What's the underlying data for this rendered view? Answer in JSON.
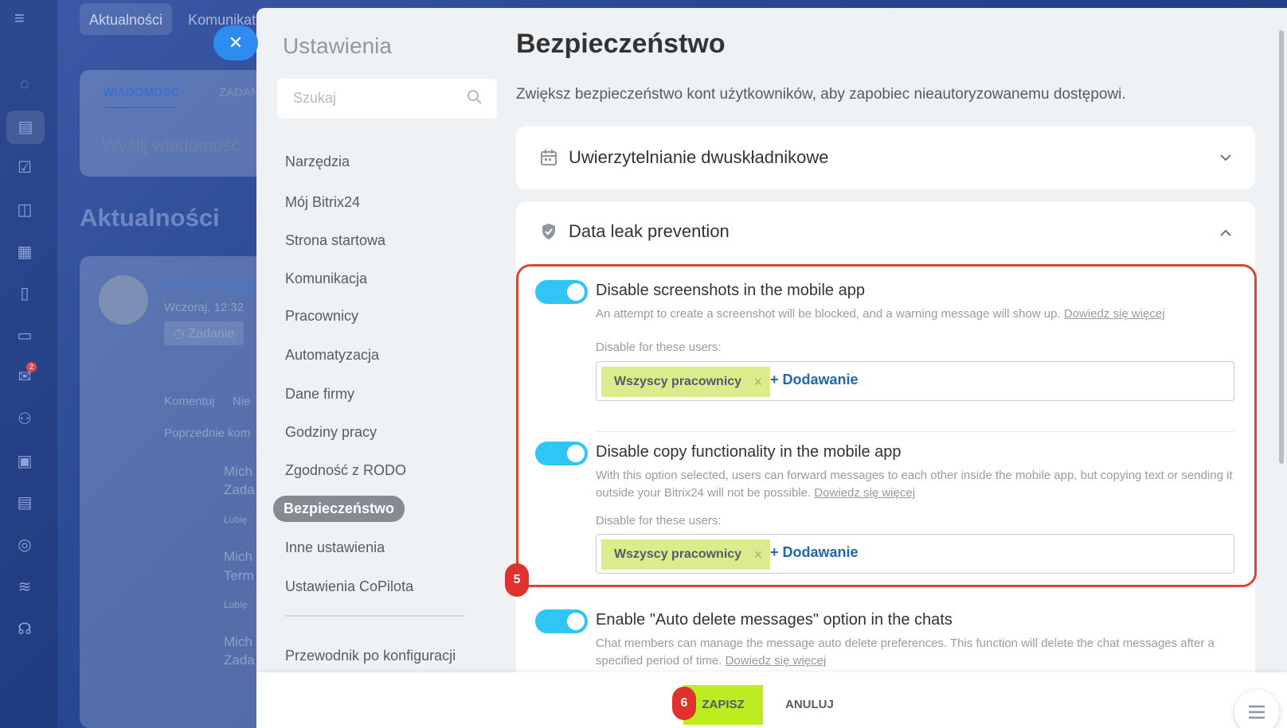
{
  "background": {
    "top_tabs": [
      "Aktualności",
      "Komunikat"
    ],
    "composer_tabs": [
      "WIADOMOŚĆ",
      "ZADAN"
    ],
    "composer_placeholder": "Wyślij wiadomość",
    "feed_title": "Aktualności",
    "post_author": "Michał Radełko",
    "post_time": "Wczoraj, 12:32",
    "post_tag": "Zadanie",
    "post_actions": [
      "Komentuj",
      "Nie"
    ],
    "prev_comments": "Poprzednie kom",
    "comment_stub_1": "Mich",
    "comment_stub_1_sub": "Zada",
    "comment_stub_2": "Mich",
    "comment_stub_2_sub": "Term",
    "comment_stub_3": "Mich",
    "comment_stub_3_sub": "Zada",
    "likes_stub": "Lubię",
    "mail_badge": "2"
  },
  "settings": {
    "sidebar_title": "Ustawienia",
    "search_placeholder": "Szukaj",
    "nav": [
      {
        "label": "Narzędzia"
      },
      {
        "label": "Mój Bitrix24"
      },
      {
        "label": "Strona startowa"
      },
      {
        "label": "Komunikacja"
      },
      {
        "label": "Pracownicy"
      },
      {
        "label": "Automatyzacja"
      },
      {
        "label": "Dane firmy"
      },
      {
        "label": "Godziny pracy"
      },
      {
        "label": "Zgodność z RODO"
      },
      {
        "label": "Bezpieczeństwo",
        "active": true
      },
      {
        "label": "Inne ustawienia"
      },
      {
        "label": "Ustawienia CoPilota"
      }
    ],
    "config_guide": "Przewodnik po konfiguracji",
    "page_title": "Bezpieczeństwo",
    "page_description": "Zwiększ bezpieczeństwo kont użytkowników, aby zapobiec nieautoryzowanemu dostępowi.",
    "sections": [
      {
        "title": "Uwierzytelnianie dwuskładnikowe",
        "icon": "calendar-icon",
        "expanded": false
      },
      {
        "title": "Data leak prevention",
        "icon": "shield-check-icon",
        "expanded": true
      }
    ],
    "options": [
      {
        "title": "Disable screenshots in the mobile app",
        "description": "An attempt to create a screenshot will be blocked, and a warning message will show up.",
        "learn_more": "Dowiedz się więcej",
        "enabled": true,
        "users_label": "Disable for these users:",
        "users_chip": "Wszyscy pracownicy",
        "add_label": "+ Dodawanie"
      },
      {
        "title": "Disable copy functionality in the mobile app",
        "description": "With this option selected, users can forward messages to each other inside the mobile app, but copying text or sending it outside your Bitrix24 will not be possible.",
        "learn_more": "Dowiedz się więcej",
        "enabled": true,
        "users_label": "Disable for these users:",
        "users_chip": "Wszyscy pracownicy",
        "add_label": "+ Dodawanie"
      },
      {
        "title": "Enable \"Auto delete messages\" option in the chats",
        "description": "Chat members can manage the message auto delete preferences. This function will delete the chat messages after a specified period of time.",
        "learn_more": "Dowiedz się więcej",
        "enabled": true
      }
    ],
    "step_badges": [
      "5",
      "6"
    ],
    "save_label": "ZAPISZ",
    "cancel_label": "ANULUJ"
  },
  "colors": {
    "accent_toggle": "#2fc6f6",
    "save_button": "#bbed21",
    "highlight_frame": "#d8472e",
    "step_badge": "#e0312d"
  }
}
